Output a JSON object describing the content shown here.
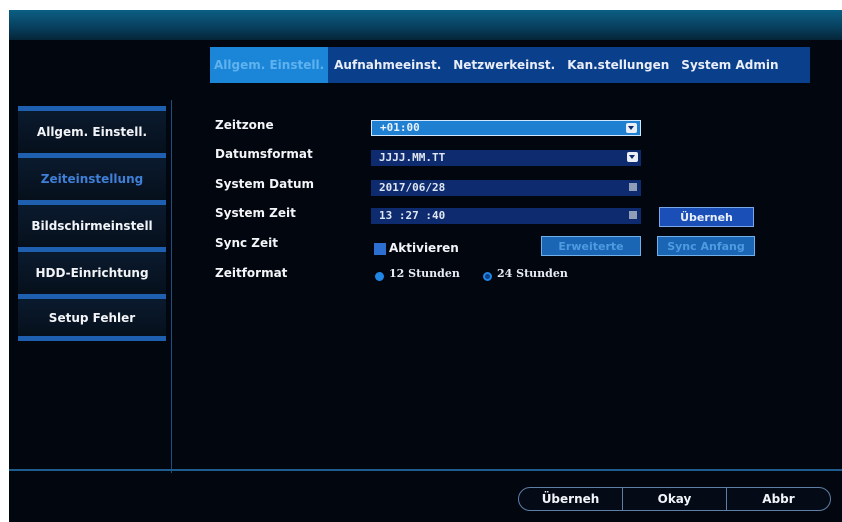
{
  "tabs": [
    {
      "label": "Allgem. Einstell.",
      "active": true
    },
    {
      "label": "Aufnahmeeinst.",
      "active": false
    },
    {
      "label": "Netzwerkeinst.",
      "active": false
    },
    {
      "label": "Kan.stellungen",
      "active": false
    },
    {
      "label": "System Admin",
      "active": false
    }
  ],
  "sidebar": {
    "items": [
      {
        "label": "Allgem. Einstell."
      },
      {
        "label": "Zeiteinstellung",
        "active": true
      },
      {
        "label": "Bildschirmeinstell"
      },
      {
        "label": "HDD-Einrichtung"
      },
      {
        "label": "Setup Fehler"
      }
    ]
  },
  "form": {
    "timezone_label": "Zeitzone",
    "timezone_value": "+01:00",
    "dateformat_label": "Datumsformat",
    "dateformat_value": "JJJJ.MM.TT",
    "sysdate_label": "System Datum",
    "sysdate_value": "2017/06/28",
    "systime_label": "System Zeit",
    "systime_value": "13 :27 :40",
    "apply_label": "Überneh",
    "sync_label": "Sync Zeit",
    "sync_checkbox_label": "Aktivieren",
    "advanced_label": "Erweiterte",
    "sync_start_label": "Sync Anfang",
    "timeformat_label": "Zeitformat",
    "timeformat_12": "12 Stunden",
    "timeformat_24": "24 Stunden",
    "timeformat_selected": "12 Stunden"
  },
  "footer": {
    "apply": "Überneh",
    "ok": "Okay",
    "cancel": "Abbr"
  },
  "colors": {
    "background": "#02060f",
    "tab_bar": "#0a3f8c",
    "active_tab": "#1b86d8",
    "field": "#0d2b6e"
  }
}
